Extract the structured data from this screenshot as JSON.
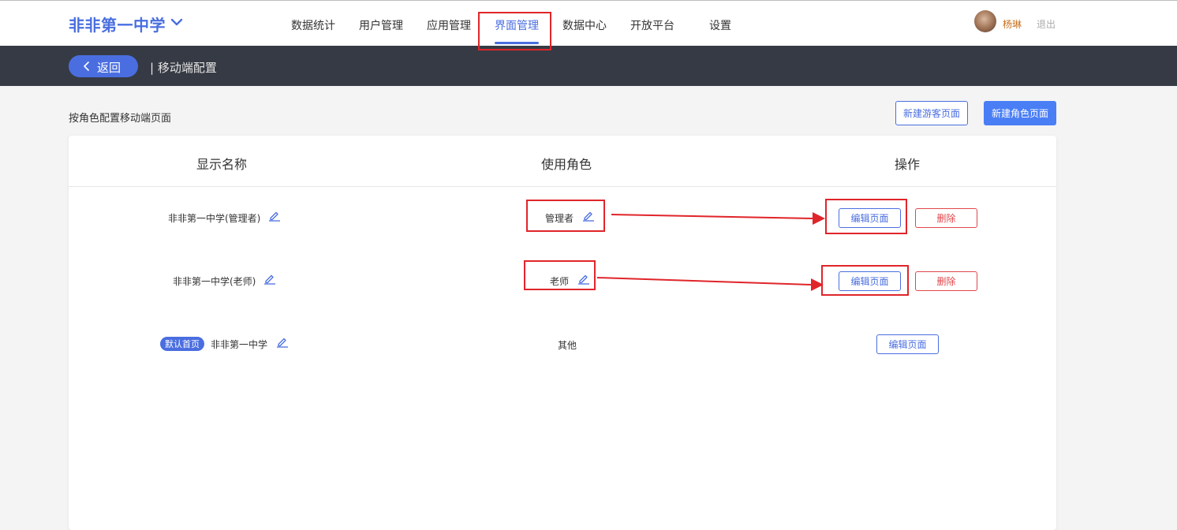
{
  "header": {
    "school_name": "非非第一中学",
    "nav_items": [
      {
        "label": "数据统计"
      },
      {
        "label": "用户管理"
      },
      {
        "label": "应用管理"
      },
      {
        "label": "界面管理",
        "active": true
      },
      {
        "label": "数据中心"
      },
      {
        "label": "开放平台"
      },
      {
        "label": "设置"
      }
    ],
    "username": "杨琳",
    "logout_label": "退出"
  },
  "subbar": {
    "back_label": "返回",
    "breadcrumb": "| 移动端配置"
  },
  "main": {
    "section_title": "按角色配置移动端页面",
    "new_guest_button": "新建游客页面",
    "new_role_button": "新建角色页面",
    "table": {
      "headers": [
        "显示名称",
        "使用角色",
        "操作"
      ],
      "rows": [
        {
          "name": "非非第一中学(管理者)",
          "role": "管理者",
          "edit_label": "编辑页面",
          "delete_label": "删除"
        },
        {
          "name": "非非第一中学(老师)",
          "role": "老师",
          "edit_label": "编辑页面",
          "delete_label": "删除"
        },
        {
          "badge": "默认首页",
          "name": "非非第一中学",
          "role": "其他",
          "edit_label": "编辑页面"
        }
      ]
    }
  },
  "colors": {
    "accent": "#4a6ee0",
    "subbar_bg": "#363a44",
    "danger": "#e0474c",
    "annotation_red": "#e0252a"
  }
}
